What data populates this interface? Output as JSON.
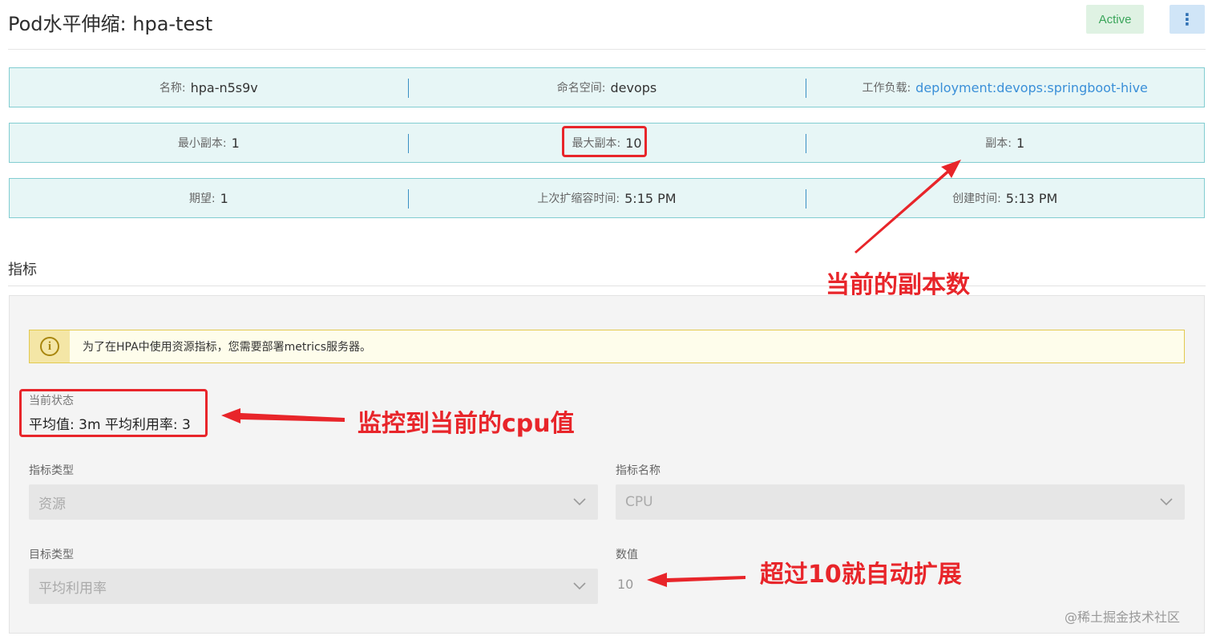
{
  "header": {
    "title": "Pod水平伸缩: hpa-test",
    "status": "Active",
    "more_icon": "⋮"
  },
  "info": {
    "row1": [
      {
        "label": "名称:",
        "value": "hpa-n5s9v"
      },
      {
        "label": "命名空间:",
        "value": "devops"
      },
      {
        "label": "工作负载:",
        "value": "deployment:devops:springboot-hive"
      }
    ],
    "row2": [
      {
        "label": "最小副本:",
        "value": "1"
      },
      {
        "label": "最大副本:",
        "value": "10"
      },
      {
        "label": "副本:",
        "value": "1"
      }
    ],
    "row3": [
      {
        "label": "期望:",
        "value": "1"
      },
      {
        "label": "上次扩缩容时间:",
        "value": "5:15 PM"
      },
      {
        "label": "创建时间:",
        "value": "5:13 PM"
      }
    ]
  },
  "metrics": {
    "section_title": "指标",
    "warning_icon": "i",
    "warning_text": "为了在HPA中使用资源指标，您需要部署metrics服务器。",
    "current_status_label": "当前状态",
    "current_status_value": "平均值: 3m 平均利用率: 3",
    "metric_type_label": "指标类型",
    "metric_type_value": "资源",
    "metric_name_label": "指标名称",
    "metric_name_value": "CPU",
    "target_type_label": "目标类型",
    "target_type_value": "平均利用率",
    "value_label": "数值",
    "value_value": "10"
  },
  "annotations": {
    "replicas": "当前的副本数",
    "cpu": "监控到当前的cpu值",
    "autoscale": "超过10就自动扩展"
  },
  "watermark": "@稀土掘金技术社区",
  "colors": {
    "annotation": "#e8252a",
    "badge_bg": "#dff2e3",
    "badge_text": "#3aa55a",
    "info_bg": "#e7f6f6",
    "link": "#3a8fd8"
  }
}
